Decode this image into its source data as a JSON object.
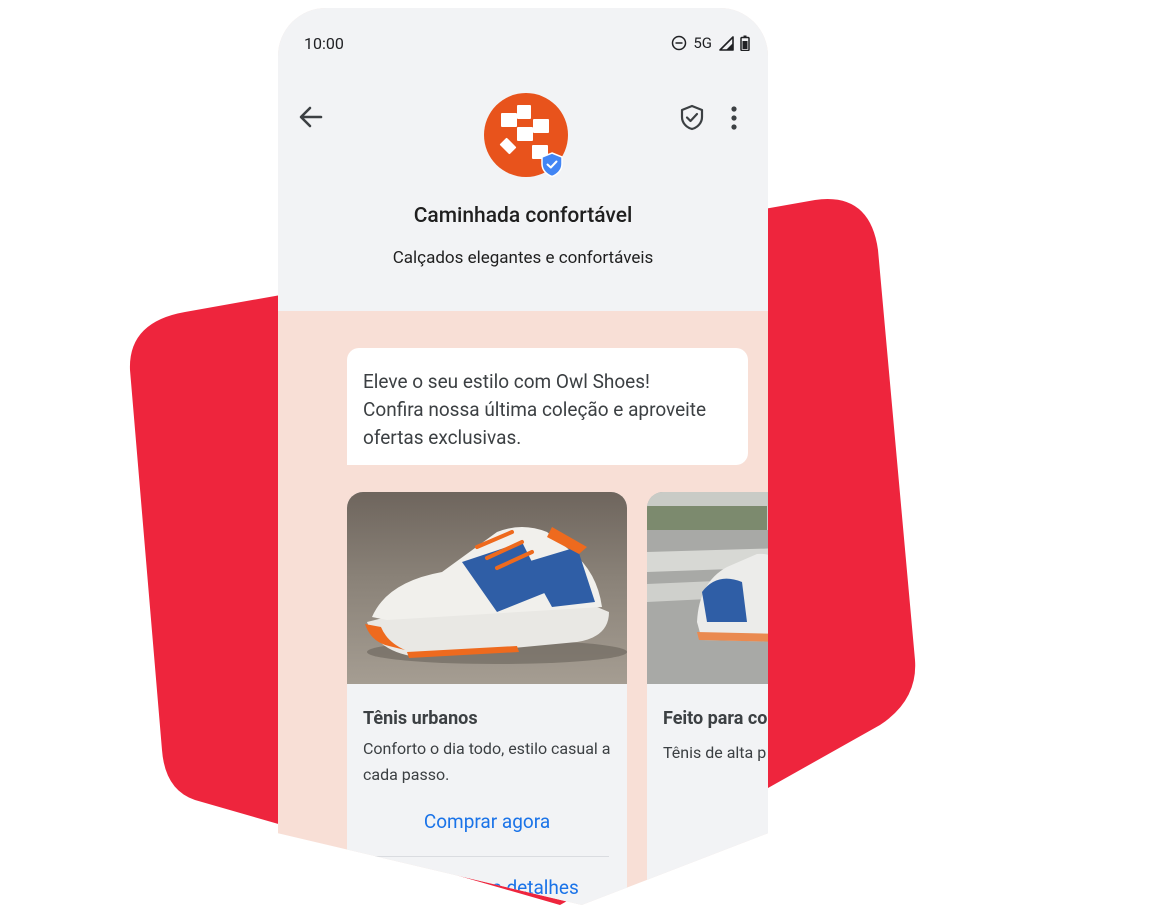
{
  "status_bar": {
    "time": "10:00",
    "network": "5G"
  },
  "header": {
    "brand_name": "Caminhada confortável",
    "brand_description": "Calçados elegantes e confortáveis"
  },
  "message": {
    "lines": [
      "Eleve o seu estilo com Owl Shoes!",
      "Confira nossa última coleção e aproveite",
      "ofertas exclusivas."
    ]
  },
  "cards": [
    {
      "title": "Tênis urbanos",
      "description": "Conforto o dia todo, estilo casual a cada passo.",
      "primary_action": "Comprar agora",
      "secondary_action": "Ver todos os detalhes"
    },
    {
      "title": "Feito para co",
      "description": "Tênis de alta p projetado para ritmo."
    }
  ],
  "colors": {
    "backdrop_red": "#ee253d",
    "brand_orange": "#e8531c",
    "chat_background": "#f8dfd6",
    "header_background": "#f2f3f5",
    "link_blue": "#1a73e8",
    "verified_blue": "#4285f4"
  },
  "icons": [
    "back-arrow-icon",
    "shield-check-icon",
    "more-vert-icon",
    "dnd-icon",
    "signal-icon",
    "battery-icon",
    "verified-badge-icon"
  ]
}
